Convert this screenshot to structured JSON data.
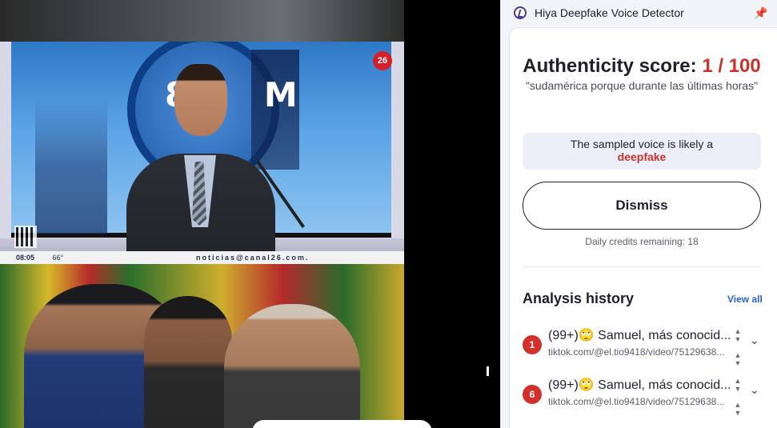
{
  "video": {
    "channel_badge": "26",
    "studio_text": "8 M",
    "ticker_time": "08:05",
    "ticker_temp": "66°",
    "ticker_site": "noticias@canal26.com."
  },
  "extension": {
    "title": "Hiya Deepfake Voice Detector",
    "score_label": "Authenticity score:",
    "score_value": "1 / 100",
    "quote": "\"sudamérica porque durante las últimas horas\"",
    "verdict_prefix": "The sampled voice is likely a",
    "verdict_word": "deepfake",
    "dismiss_label": "Dismiss",
    "credits": "Daily credits remaining: 18",
    "history_title": "Analysis history",
    "view_all": "View all",
    "history": [
      {
        "badge": "1",
        "title": "(99+)🙄 Samuel, más conocid...",
        "url": "tiktok.com/@el.tio9418/video/75129638..."
      },
      {
        "badge": "6",
        "title": "(99+)🙄 Samuel, más conocid...",
        "url": "tiktok.com/@el.tio9418/video/75129638..."
      }
    ],
    "colors": {
      "accent_red": "#c8342c",
      "link_blue": "#2a62c9",
      "badge_red": "#d3302b"
    }
  }
}
